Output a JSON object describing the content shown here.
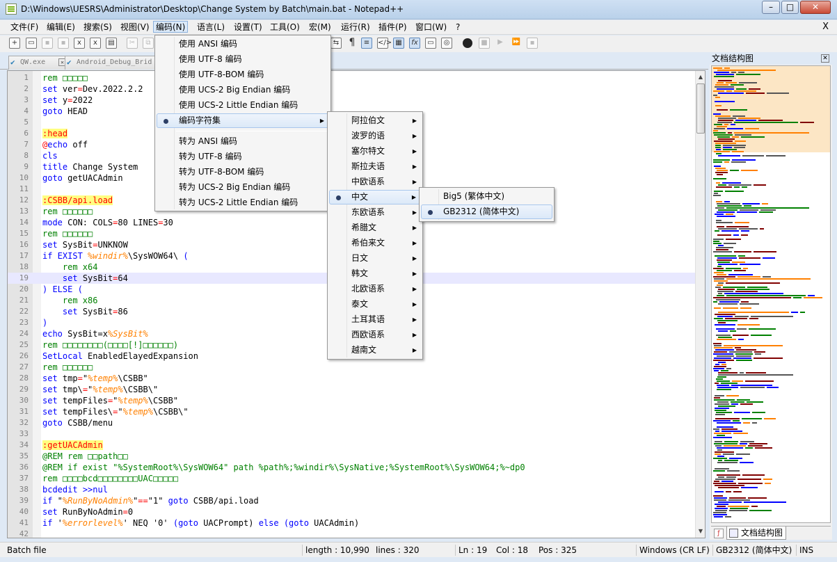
{
  "window": {
    "title": "D:\\Windows\\UESRS\\Administrator\\Desktop\\Change System by Batch\\main.bat - Notepad++",
    "minimize": "–",
    "maximize": "□",
    "close": "✕"
  },
  "menubar": {
    "items": [
      "文件(F)",
      "编辑(E)",
      "搜索(S)",
      "视图(V)",
      "编码(N)",
      "语言(L)",
      "设置(T)",
      "工具(O)",
      "宏(M)",
      "运行(R)",
      "插件(P)",
      "窗口(W)",
      "?"
    ],
    "close_x": "X"
  },
  "toolbar": {
    "icons": [
      "new-file-icon",
      "open-file-icon",
      "save-icon",
      "save-all-icon",
      "close-icon",
      "close-all-icon",
      "print-icon",
      "copy-icon",
      "cut-icon",
      "paste-icon",
      "pilcrow-icon",
      "indent-guide-icon",
      "xml-tag-icon",
      "document-map-icon",
      "function-list-icon",
      "monitor-icon",
      "folder-workspace-icon",
      "record-macro-icon",
      "stop-macro-icon",
      "play-macro-icon",
      "run-multiple-macro-icon",
      "save-macro-icon"
    ],
    "pilcrow": "¶",
    "fx": "fx"
  },
  "tabs": [
    {
      "label": "QW.exe",
      "active": false
    },
    {
      "label": "Android_Debug_Brid",
      "active": false
    }
  ],
  "editor": {
    "lines": [
      {
        "n": "1",
        "segs": [
          {
            "t": "rem ",
            "c": "cm"
          },
          {
            "t": "□□□□□",
            "c": "cm"
          }
        ]
      },
      {
        "n": "2",
        "segs": [
          {
            "t": "set",
            "c": "kw"
          },
          {
            "t": " ver",
            "c": ""
          },
          {
            "t": "=",
            "c": "op"
          },
          {
            "t": "Dev.2022.2.2",
            "c": ""
          }
        ]
      },
      {
        "n": "3",
        "segs": [
          {
            "t": "set",
            "c": "kw"
          },
          {
            "t": " y",
            "c": ""
          },
          {
            "t": "=",
            "c": "op"
          },
          {
            "t": "2022",
            "c": ""
          }
        ]
      },
      {
        "n": "4",
        "segs": [
          {
            "t": "goto",
            "c": "kw"
          },
          {
            "t": " HEAD",
            "c": ""
          }
        ]
      },
      {
        "n": "5",
        "segs": []
      },
      {
        "n": "6",
        "segs": [
          {
            "t": ":head",
            "c": "lbl"
          }
        ]
      },
      {
        "n": "7",
        "segs": [
          {
            "t": "@",
            "c": "op"
          },
          {
            "t": "echo",
            "c": "kw"
          },
          {
            "t": " off",
            "c": ""
          }
        ]
      },
      {
        "n": "8",
        "segs": [
          {
            "t": "cls",
            "c": "kw"
          }
        ]
      },
      {
        "n": "9",
        "segs": [
          {
            "t": "title",
            "c": "kw"
          },
          {
            "t": " Change System",
            "c": ""
          }
        ]
      },
      {
        "n": "10",
        "segs": [
          {
            "t": "goto",
            "c": "kw"
          },
          {
            "t": " getUACAdmin",
            "c": ""
          }
        ]
      },
      {
        "n": "11",
        "segs": []
      },
      {
        "n": "12",
        "segs": [
          {
            "t": ":CSBB/api.load",
            "c": "lbl"
          }
        ]
      },
      {
        "n": "13",
        "segs": [
          {
            "t": "rem □□□□□□",
            "c": "cm"
          }
        ]
      },
      {
        "n": "14",
        "segs": [
          {
            "t": "mode",
            "c": "kw"
          },
          {
            "t": " CON: COLS",
            "c": ""
          },
          {
            "t": "=",
            "c": "op"
          },
          {
            "t": "80 LINES",
            "c": ""
          },
          {
            "t": "=",
            "c": "op"
          },
          {
            "t": "30",
            "c": ""
          }
        ]
      },
      {
        "n": "15",
        "segs": [
          {
            "t": "rem □□□□□□",
            "c": "cm"
          }
        ]
      },
      {
        "n": "16",
        "segs": [
          {
            "t": "set",
            "c": "kw"
          },
          {
            "t": " SysBit",
            "c": ""
          },
          {
            "t": "=",
            "c": "op"
          },
          {
            "t": "UNKNOW",
            "c": ""
          }
        ]
      },
      {
        "n": "17",
        "segs": [
          {
            "t": "if EXIST",
            "c": "kw"
          },
          {
            "t": " ",
            "c": ""
          },
          {
            "t": "%windir%",
            "c": "var"
          },
          {
            "t": "\\SysWOW64\\ ",
            "c": ""
          },
          {
            "t": "(",
            "c": "kw"
          }
        ]
      },
      {
        "n": "18",
        "segs": [
          {
            "t": "    rem x64",
            "c": "cm"
          }
        ]
      },
      {
        "n": "19",
        "segs": [
          {
            "t": "    ",
            "c": ""
          },
          {
            "t": "set",
            "c": "kw"
          },
          {
            "t": " SysBit",
            "c": ""
          },
          {
            "t": "=",
            "c": "op"
          },
          {
            "t": "64",
            "c": ""
          }
        ],
        "cur": true
      },
      {
        "n": "20",
        "segs": [
          {
            "t": ") ELSE (",
            "c": "kw"
          }
        ]
      },
      {
        "n": "21",
        "segs": [
          {
            "t": "    rem x86",
            "c": "cm"
          }
        ]
      },
      {
        "n": "22",
        "segs": [
          {
            "t": "    ",
            "c": ""
          },
          {
            "t": "set",
            "c": "kw"
          },
          {
            "t": " SysBit",
            "c": ""
          },
          {
            "t": "=",
            "c": "op"
          },
          {
            "t": "86",
            "c": ""
          }
        ]
      },
      {
        "n": "23",
        "segs": [
          {
            "t": ")",
            "c": "kw"
          }
        ]
      },
      {
        "n": "24",
        "segs": [
          {
            "t": "echo",
            "c": "kw"
          },
          {
            "t": " SysBit=x",
            "c": ""
          },
          {
            "t": "%SysBit%",
            "c": "var"
          }
        ]
      },
      {
        "n": "25",
        "segs": [
          {
            "t": "rem □□□□□□□□(□□□□[!]□□□□□□)",
            "c": "cm"
          }
        ]
      },
      {
        "n": "26",
        "segs": [
          {
            "t": "SetLocal",
            "c": "kw"
          },
          {
            "t": " EnabledElayedExpansion",
            "c": ""
          }
        ]
      },
      {
        "n": "27",
        "segs": [
          {
            "t": "rem □□□□□□",
            "c": "cm"
          }
        ]
      },
      {
        "n": "28",
        "segs": [
          {
            "t": "set",
            "c": "kw"
          },
          {
            "t": " tmp",
            "c": ""
          },
          {
            "t": "=",
            "c": "op"
          },
          {
            "t": "\"",
            "c": ""
          },
          {
            "t": "%temp%",
            "c": "var"
          },
          {
            "t": "\\CSBB\"",
            "c": ""
          }
        ]
      },
      {
        "n": "29",
        "segs": [
          {
            "t": "set",
            "c": "kw"
          },
          {
            "t": " tmp\\",
            "c": ""
          },
          {
            "t": "=",
            "c": "op"
          },
          {
            "t": "\"",
            "c": ""
          },
          {
            "t": "%temp%",
            "c": "var"
          },
          {
            "t": "\\CSBB\\\"",
            "c": ""
          }
        ]
      },
      {
        "n": "30",
        "segs": [
          {
            "t": "set",
            "c": "kw"
          },
          {
            "t": " tempFiles",
            "c": ""
          },
          {
            "t": "=",
            "c": "op"
          },
          {
            "t": "\"",
            "c": ""
          },
          {
            "t": "%temp%",
            "c": "var"
          },
          {
            "t": "\\CSBB\"",
            "c": ""
          }
        ]
      },
      {
        "n": "31",
        "segs": [
          {
            "t": "set",
            "c": "kw"
          },
          {
            "t": " tempFiles\\",
            "c": ""
          },
          {
            "t": "=",
            "c": "op"
          },
          {
            "t": "\"",
            "c": ""
          },
          {
            "t": "%temp%",
            "c": "var"
          },
          {
            "t": "\\CSBB\\\"",
            "c": ""
          }
        ]
      },
      {
        "n": "32",
        "segs": [
          {
            "t": "goto",
            "c": "kw"
          },
          {
            "t": " CSBB/menu",
            "c": ""
          }
        ]
      },
      {
        "n": "33",
        "segs": []
      },
      {
        "n": "34",
        "segs": [
          {
            "t": ":getUACAdmin",
            "c": "lbl"
          }
        ]
      },
      {
        "n": "35",
        "segs": [
          {
            "t": "@REM rem □□path□□",
            "c": "cm"
          }
        ]
      },
      {
        "n": "36",
        "segs": [
          {
            "t": "@REM if exist \"%SystemRoot%\\SysWOW64\" path %path%;%windir%\\SysNative;%SystemRoot%\\SysWOW64;%~dp0",
            "c": "cm"
          }
        ]
      },
      {
        "n": "37",
        "segs": [
          {
            "t": "rem □□□□bcd□□□□□□□□UAC□□□□□",
            "c": "cm"
          }
        ]
      },
      {
        "n": "38",
        "segs": [
          {
            "t": "bcdedit",
            "c": "kw"
          },
          {
            "t": " ",
            "c": ""
          },
          {
            "t": ">>nul",
            "c": "kw"
          }
        ]
      },
      {
        "n": "39",
        "segs": [
          {
            "t": "if",
            "c": "kw"
          },
          {
            "t": " \"",
            "c": ""
          },
          {
            "t": "%RunByNoAdmin%",
            "c": "var"
          },
          {
            "t": "\"",
            "c": ""
          },
          {
            "t": "==",
            "c": "op"
          },
          {
            "t": "\"1\" ",
            "c": ""
          },
          {
            "t": "goto",
            "c": "kw"
          },
          {
            "t": " CSBB/api.load",
            "c": ""
          }
        ]
      },
      {
        "n": "40",
        "segs": [
          {
            "t": "set",
            "c": "kw"
          },
          {
            "t": " RunByNoAdmin",
            "c": ""
          },
          {
            "t": "=",
            "c": "op"
          },
          {
            "t": "0",
            "c": ""
          }
        ]
      },
      {
        "n": "41",
        "segs": [
          {
            "t": "if",
            "c": "kw"
          },
          {
            "t": " '",
            "c": ""
          },
          {
            "t": "%errorlevel%",
            "c": "var"
          },
          {
            "t": "' NEQ '0' ",
            "c": ""
          },
          {
            "t": "(goto",
            "c": "kw"
          },
          {
            "t": " UACPrompt) ",
            "c": ""
          },
          {
            "t": "else",
            "c": "kw"
          },
          {
            "t": " ",
            "c": ""
          },
          {
            "t": "(goto",
            "c": "kw"
          },
          {
            "t": " UACAdmin)",
            "c": ""
          }
        ]
      },
      {
        "n": "42",
        "segs": []
      }
    ]
  },
  "encoding_menu": {
    "items": [
      {
        "label": "使用 ANSI 编码"
      },
      {
        "label": "使用 UTF-8 编码"
      },
      {
        "label": "使用 UTF-8-BOM 编码"
      },
      {
        "label": "使用 UCS-2 Big Endian 编码"
      },
      {
        "label": "使用 UCS-2 Little Endian 编码"
      },
      {
        "label": "编码字符集",
        "selected": true,
        "submenu": true
      },
      {
        "label": "转为 ANSI 编码"
      },
      {
        "label": "转为 UTF-8 编码"
      },
      {
        "label": "转为 UTF-8-BOM 编码"
      },
      {
        "label": "转为 UCS-2 Big Endian 编码"
      },
      {
        "label": "转为 UCS-2 Little Endian 编码"
      }
    ]
  },
  "charset_menu": {
    "items": [
      "阿拉伯文",
      "波罗的语",
      "塞尔特文",
      "斯拉夫语",
      "中欧语系",
      "中文",
      "东欧语系",
      "希腊文",
      "希伯来文",
      "日文",
      "韩文",
      "北欧语系",
      "泰文",
      "土耳其语",
      "西欧语系",
      "越南文"
    ],
    "selected": "中文"
  },
  "chinese_menu": {
    "items": [
      "Big5 (繁体中文)",
      "GB2312 (简体中文)"
    ],
    "selected": "GB2312 (简体中文)"
  },
  "docmap": {
    "title": "文档结构图",
    "close": "✕",
    "tab_label": "文档结构图"
  },
  "status": {
    "filetype": "Batch file",
    "length": "length : 10,990",
    "lines": "lines : 320",
    "ln": "Ln : 19",
    "col": "Col : 18",
    "pos": "Pos : 325",
    "eol": "Windows (CR LF)",
    "encoding": "GB2312 (简体中文)",
    "mode": "INS"
  }
}
